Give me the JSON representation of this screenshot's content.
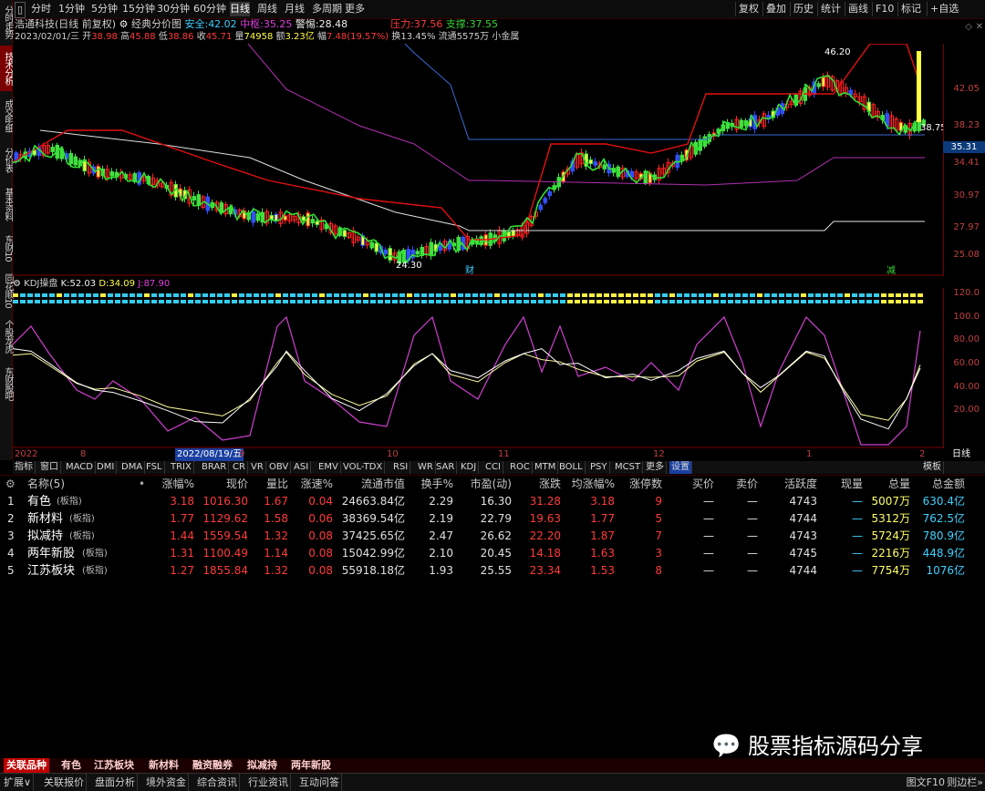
{
  "left_tabs": [
    "分时走势",
    "技术分析",
    "成交明细",
    "分价表",
    "基本资料",
    "东财10",
    "同花顺10",
    "个股龙虎",
    "东财股吧"
  ],
  "top_periods": [
    "分时",
    "1分钟",
    "5分钟",
    "15分钟",
    "30分钟",
    "60分钟",
    "日线",
    "周线",
    "月线",
    "多周期",
    "更多"
  ],
  "top_right_buttons": [
    "复权",
    "叠加",
    "历史",
    "统计",
    "画线",
    "F10",
    "标记",
    "+自选"
  ],
  "stock": {
    "name": "浩通科技(日线 前复权)",
    "indicator_name": "经典分价图",
    "safe_label": "安全:",
    "safe_value": "42.02",
    "mid_label": "中枢:",
    "mid_value": "35.25",
    "alert_label": "警惕:",
    "alert_value": "28.48",
    "pressure_label": "压力:",
    "pressure_value": "37.56",
    "support_label": "支撑:",
    "support_value": "37.55",
    "date": "2023/02/01/三",
    "open_label": "开",
    "open": "38.98",
    "high_label": "高",
    "high": "45.88",
    "low_label": "低",
    "low": "38.86",
    "close_label": "收",
    "close": "45.71",
    "volume_label": "量",
    "volume": "74958",
    "amount_label": "额",
    "amount": "3.23亿",
    "change_label": "幅",
    "change": "7.48(19.57%)",
    "turnover_label": "换",
    "turnover": "13.45%",
    "float_label": "流通",
    "float": "5575万",
    "size_label": "小金属"
  },
  "price_axis": [
    "42.05",
    "38.23",
    "34.41",
    "30.97",
    "27.97",
    "25.08"
  ],
  "current_price_tag": "35.31",
  "chart_annotations": {
    "high_mark": "46.20",
    "low_mark": "24.30",
    "last_mark": "38.75",
    "fin_mark": "财",
    "reduce_mark": "减"
  },
  "kdj": {
    "name": "KDJ操盘",
    "k_label": "K:",
    "k": "52.03",
    "d_label": "D:",
    "d": "34.09",
    "j_label": "J:",
    "j": "87.90"
  },
  "kdj_axis": [
    "120.0",
    "100.0",
    "80.00",
    "60.00",
    "40.00",
    "20.00"
  ],
  "date_axis": {
    "labels": [
      "2022",
      "8",
      "9",
      "10",
      "11",
      "12",
      "1",
      "2"
    ],
    "cursor_date": "2022/08/19/五",
    "period": "日线"
  },
  "indicator_tabs": [
    "指标",
    "窗口",
    "MACD",
    "DMI",
    "DMA",
    "FSL",
    "TRIX",
    "BRAR",
    "CR",
    "VR",
    "OBV",
    "ASI",
    "EMV",
    "VOL-TDX",
    "RSI",
    "WR",
    "SAR",
    "KDJ",
    "CCI",
    "ROC",
    "MTM",
    "BOLL",
    "PSY",
    "MCST",
    "更多",
    "设置"
  ],
  "template_label": "模板",
  "table": {
    "name_header": "名称(5)",
    "columns": [
      "涨幅%",
      "现价",
      "量比",
      "涨速%",
      "流通市值",
      "换手%",
      "市盈(动)",
      "涨跌",
      "均涨幅%",
      "涨停数",
      "买价",
      "卖价",
      "活跃度",
      "现量",
      "总量",
      "总金额"
    ],
    "rows": [
      {
        "idx": "1",
        "name": "有色",
        "tag": "(板指)",
        "cells": [
          "3.18",
          "1016.30",
          "1.67",
          "0.04",
          "24663.84亿",
          "2.29",
          "16.30",
          "31.28",
          "3.18",
          "9",
          "—",
          "—",
          "4743",
          "—",
          "5007万",
          "630.4亿"
        ]
      },
      {
        "idx": "2",
        "name": "新材料",
        "tag": "(板指)",
        "cells": [
          "1.77",
          "1129.62",
          "1.58",
          "0.06",
          "38369.54亿",
          "2.19",
          "22.79",
          "19.63",
          "1.77",
          "5",
          "—",
          "—",
          "4744",
          "—",
          "5312万",
          "762.5亿"
        ]
      },
      {
        "idx": "3",
        "name": "拟减持",
        "tag": "(板指)",
        "cells": [
          "1.44",
          "1559.54",
          "1.32",
          "0.08",
          "37425.65亿",
          "2.47",
          "26.62",
          "22.20",
          "1.87",
          "7",
          "—",
          "—",
          "4743",
          "—",
          "5724万",
          "780.9亿"
        ]
      },
      {
        "idx": "4",
        "name": "两年新股",
        "tag": "(板指)",
        "cells": [
          "1.31",
          "1100.49",
          "1.14",
          "0.08",
          "15042.99亿",
          "2.10",
          "20.45",
          "14.18",
          "1.63",
          "3",
          "—",
          "—",
          "4745",
          "—",
          "2216万",
          "448.9亿"
        ]
      },
      {
        "idx": "5",
        "name": "江苏板块",
        "tag": "(板指)",
        "cells": [
          "1.27",
          "1855.84",
          "1.32",
          "0.08",
          "55918.18亿",
          "1.93",
          "25.55",
          "23.34",
          "1.53",
          "8",
          "—",
          "—",
          "4744",
          "—",
          "7754万",
          "1076亿"
        ]
      }
    ]
  },
  "bottom_tabs": [
    "关联品种",
    "有色",
    "江苏板块",
    "新材料",
    "融资融券",
    "拟减持",
    "两年新股"
  ],
  "status_tabs": [
    "扩展∨",
    "关联报价",
    "盘面分析",
    "境外资金",
    "综合资讯",
    "行业资讯",
    "互动问答"
  ],
  "status_right": [
    "图文F10",
    "则边栏»"
  ],
  "watermark": "股票指标源码分享",
  "colors": {
    "up": "#ff3b3b",
    "down": "#39d339",
    "accent": "#c00000",
    "k": "#ffffff",
    "d": "#ffff80",
    "j": "#d040d0"
  }
}
